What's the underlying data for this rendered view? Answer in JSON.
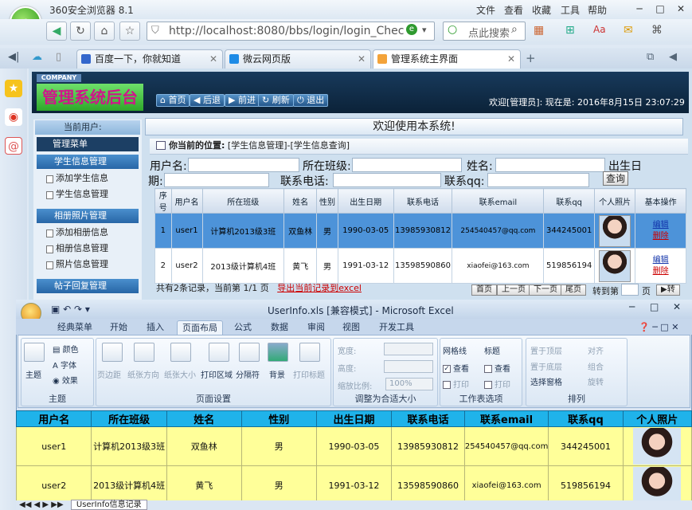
{
  "browser": {
    "title": "360安全浏览器 8.1",
    "menu": [
      "文件",
      "查看",
      "收藏",
      "工具",
      "帮助"
    ],
    "address": "http://localhost:8080/bbs/login/login_Chec",
    "search_placeholder": "点此搜索",
    "tabs": [
      {
        "label": "百度一下，你就知道"
      },
      {
        "label": "微云网页版"
      },
      {
        "label": "管理系统主界面"
      }
    ]
  },
  "app": {
    "company": "COMPANY",
    "title": "管理系统后台",
    "nav": [
      "首页",
      "后退",
      "前进",
      "刷新",
      "退出"
    ],
    "welcome_header": "欢迎[管理员]:   现在是: 2016年8月15日 23:07:29",
    "current_user_label": "当前用户:",
    "menu_title": "管理菜单",
    "sections": [
      {
        "title": "学生信息管理",
        "items": [
          "添加学生信息",
          "学生信息管理"
        ]
      },
      {
        "title": "相册照片管理",
        "items": [
          "添加相册信息",
          "相册信息管理",
          "照片信息管理"
        ]
      },
      {
        "title": "帖子回复管理",
        "items": []
      }
    ],
    "welcome_bar": "欢迎使用本系统!",
    "position_label": "你当前的位置:",
    "position_path": "[学生信息管理]-[学生信息查询]",
    "filters": {
      "username_label": "用户名:",
      "class_label": "所在班级:",
      "name_label": "姓名:",
      "birth_label_a": "出生日",
      "birth_label_b": "期:",
      "phone_label": "联系电话:",
      "qq_label": "联系qq:",
      "query_button": "查询"
    },
    "table": {
      "headers": [
        "序号",
        "用户名",
        "所在班级",
        "姓名",
        "性别",
        "出生日期",
        "联系电话",
        "联系email",
        "联系qq",
        "个人照片",
        "基本操作"
      ],
      "rows": [
        {
          "no": "1",
          "user": "user1",
          "class": "计算机2013级3班",
          "name": "双鱼林",
          "sex": "男",
          "birth": "1990-03-05",
          "phone": "13985930812",
          "email": "254540457@qq.com",
          "qq": "344245001",
          "edit": "编辑",
          "del": "删除"
        },
        {
          "no": "2",
          "user": "user2",
          "class": "2013级计算机4班",
          "name": "黄飞",
          "sex": "男",
          "birth": "1991-03-12",
          "phone": "13598590860",
          "email": "xiaofei@163.com",
          "qq": "519856194",
          "edit": "编辑",
          "del": "删除"
        }
      ]
    },
    "footer": {
      "summary": "共有2条记录，当前第 1/1 页",
      "export_link": "导出当前记录到excel",
      "buttons": [
        "首页",
        "上一页",
        "下一页",
        "尾页"
      ],
      "goto_label": "转到第",
      "page_label": "页",
      "go_button": "转"
    }
  },
  "excel": {
    "title": "UserInfo.xls [兼容模式] - Microsoft Excel",
    "ribbon_tabs": [
      "经典菜单",
      "开始",
      "插入",
      "页面布局",
      "公式",
      "数据",
      "审阅",
      "视图",
      "开发工具"
    ],
    "groups": [
      {
        "label": "主题",
        "items": [
          "主题",
          "颜色",
          "字体",
          "效果"
        ]
      },
      {
        "label": "页面设置",
        "items": [
          "页边距",
          "纸张方向",
          "纸张大小",
          "打印区域",
          "分隔符",
          "背景",
          "打印标题"
        ]
      },
      {
        "label": "调整为合适大小",
        "items": [
          "宽度:",
          "高度:",
          "缩放比例:",
          "100%"
        ]
      },
      {
        "label": "工作表选项",
        "items": [
          "网格线",
          "标题",
          "查看",
          "查看",
          "打印",
          "打印"
        ]
      },
      {
        "label": "排列",
        "items": [
          "置于顶层",
          "对齐",
          "置于底层",
          "组合",
          "选择窗格",
          "旋转"
        ]
      }
    ],
    "sheet": {
      "headers": [
        "用户名",
        "所在班级",
        "姓名",
        "性别",
        "出生日期",
        "联系电话",
        "联系email",
        "联系qq",
        "个人照片"
      ],
      "rows": [
        [
          "user1",
          "计算机2013级3班",
          "双鱼林",
          "男",
          "1990-03-05",
          "13985930812",
          "254540457@qq.com",
          "344245001"
        ],
        [
          "user2",
          "2013级计算机4班",
          "黄飞",
          "男",
          "1991-03-12",
          "13598590860",
          "xiaofei@163.com",
          "519856194"
        ]
      ],
      "tab_name": "UserInfo信息记录"
    }
  }
}
